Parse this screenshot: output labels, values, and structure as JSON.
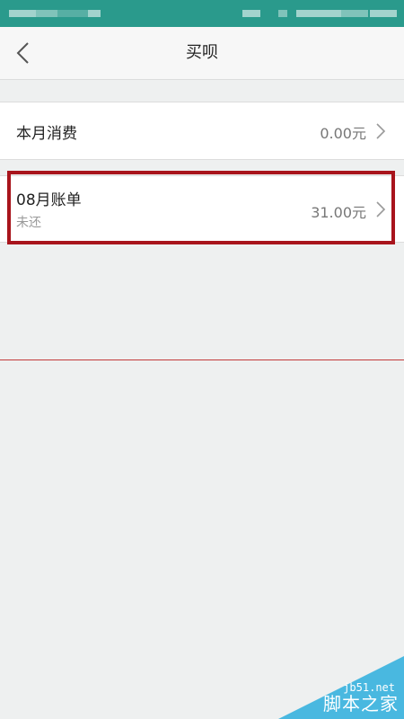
{
  "header": {
    "title": "买呗",
    "back_icon": "chevron-left-icon"
  },
  "rows": {
    "current_month": {
      "label": "本月消费",
      "value": "0.00元"
    },
    "bill": {
      "label": "08月账单",
      "status": "未还",
      "value": "31.00元"
    }
  },
  "watermark": {
    "url": "jb51.net",
    "name": "脚本之家"
  },
  "colors": {
    "status_bar": "#2a9a8c",
    "header_bg": "#f7f7f7",
    "page_bg": "#eef0f0",
    "highlight": "#a8141c",
    "watermark": "#49b8e0"
  }
}
